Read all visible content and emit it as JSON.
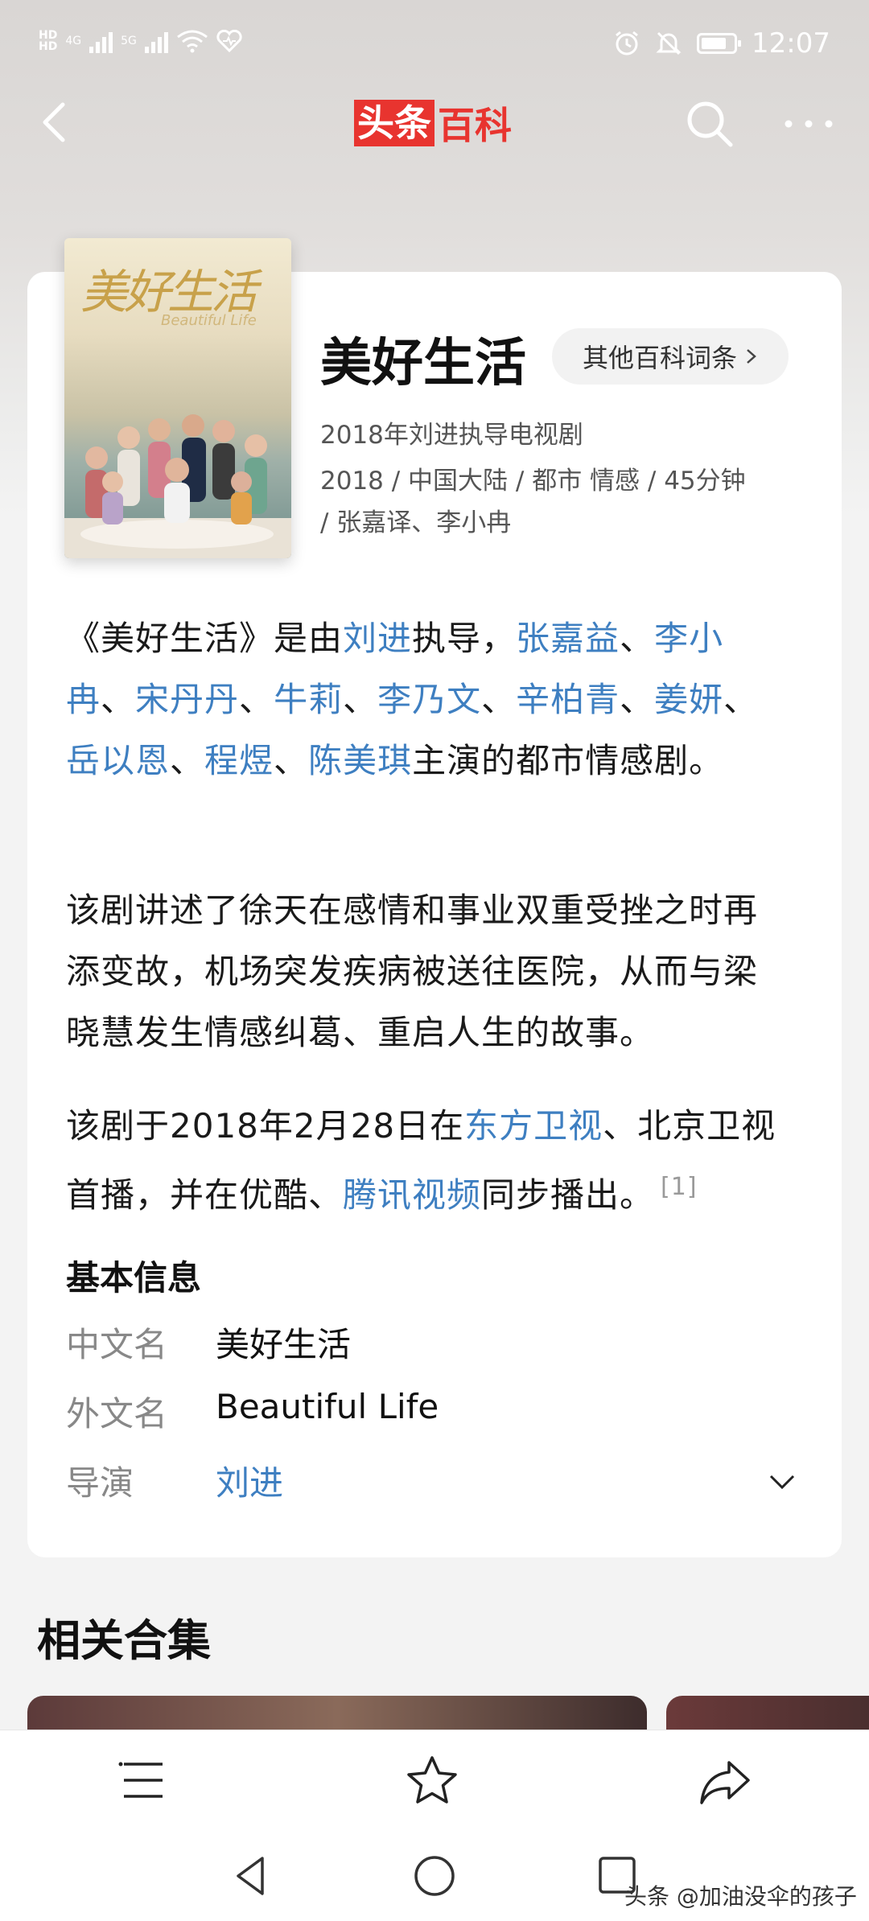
{
  "status_bar": {
    "left_icons": [
      "hd-icon",
      "signal-4g-icon",
      "signal-5g-icon",
      "wifi-icon",
      "health-icon"
    ],
    "sig1_label": "4G",
    "sig2_label": "5G",
    "time": "12:07",
    "right_icons": [
      "alarm-icon",
      "mute-icon",
      "battery-icon"
    ]
  },
  "header": {
    "logo_left": "头条",
    "logo_right": "百科"
  },
  "entry": {
    "poster_title": "美好生活",
    "poster_subtitle": "Beautiful Life",
    "title": "美好生活",
    "other_entries_label": "其他百科词条",
    "subtitle": "2018年刘进执导电视剧",
    "meta_line1": "2018 / 中国大陆 / 都市 情感 / 45分钟",
    "meta_line2": "/ 张嘉译、李小冉"
  },
  "paragraphs": {
    "p1": {
      "prefix": "《美好生活》是由",
      "director": "刘进",
      "mid": "执导，",
      "actors": [
        "张嘉益",
        "李小冉",
        "宋丹丹",
        "牛莉",
        "李乃文",
        "辛柏青",
        "姜妍",
        "岳以恩",
        "程煜",
        "陈美琪"
      ],
      "separator": "、",
      "suffix": "主演的都市情感剧。"
    },
    "p2": "该剧讲述了徐天在感情和事业双重受挫之时再添变故，机场突发疾病被送往医院，从而与梁晓慧发生情感纠葛、重启人生的故事。",
    "p3": {
      "part1": "该剧于2018年2月28日在",
      "link1": "东方卫视",
      "part2": "、北京卫视首播，并在优酷、",
      "link2": "腾讯视频",
      "part3": "同步播出。",
      "ref": "[1]"
    }
  },
  "basic_info": {
    "heading": "基本信息",
    "rows": [
      {
        "key": "中文名",
        "value": "美好生活"
      },
      {
        "key": "外文名",
        "value": "Beautiful Life"
      },
      {
        "key": "导演",
        "value": "刘进"
      }
    ]
  },
  "related": {
    "heading": "相关合集"
  },
  "watermark": "头条 @加油没伞的孩子"
}
